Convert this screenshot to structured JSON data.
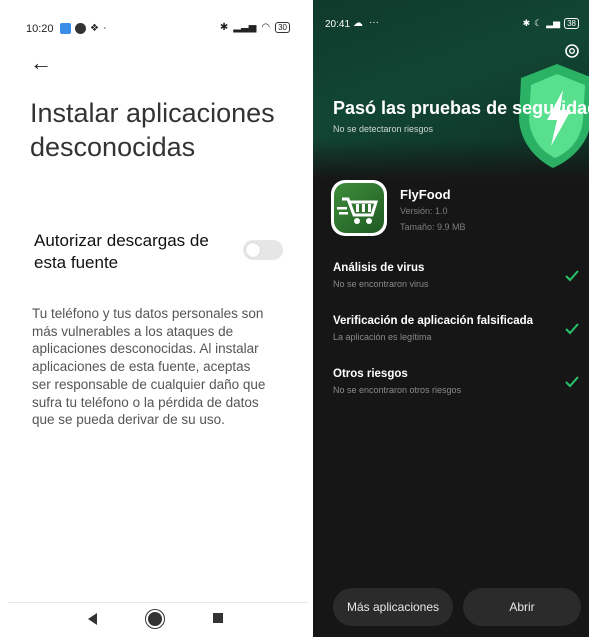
{
  "left_screen": {
    "status": {
      "time": "10:20",
      "battery": "30"
    },
    "title": "Instalar aplicaciones desconocidas",
    "setting_label": "Autorizar descargas de esta fuente",
    "toggle_on": false,
    "description": "Tu teléfono y tus datos personales son más vulnerables a los ataques de aplicaciones desconocidas. Al instalar aplicaciones de esta fuente, aceptas ser responsable de cualquier daño que sufra tu teléfono o la pérdida de datos que se pueda derivar de su uso."
  },
  "right_screen": {
    "status": {
      "time": "20:41",
      "battery": "38"
    },
    "hero_title": "Pasó las pruebas de seguridad",
    "hero_subtitle": "No se detectaron riesgos",
    "app": {
      "name": "FlyFood",
      "version": "Versión: 1.0",
      "size": "Tamaño: 9.9 MB"
    },
    "checks": [
      {
        "title": "Análisis de virus",
        "subtitle": "No se encontraron virus"
      },
      {
        "title": "Verificación de aplicación falsificada",
        "subtitle": "La aplicación es legítima"
      },
      {
        "title": "Otros riesgos",
        "subtitle": "No se encontraron otros riesgos"
      }
    ],
    "buttons": {
      "more_apps": "Más aplicaciones",
      "open": "Abrir"
    }
  },
  "colors": {
    "check_green": "#27c46a",
    "hero_green": "#124634",
    "dark_bg": "#161616"
  }
}
